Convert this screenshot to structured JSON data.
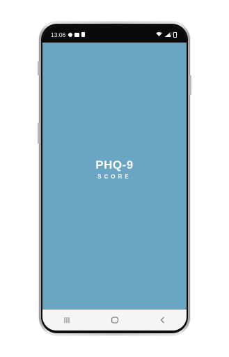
{
  "status_bar": {
    "time": "13:06",
    "left_icons": [
      "notification-icon",
      "gallery-icon",
      "sim-icon"
    ],
    "right_icons": [
      "wifi-icon",
      "signal-icon",
      "battery-icon"
    ]
  },
  "app": {
    "title": "PHQ-9",
    "subtitle": "SCORE",
    "background_color": "#6aa5c4"
  },
  "nav_bar": {
    "buttons": [
      "recents-icon",
      "home-icon",
      "back-icon"
    ]
  }
}
